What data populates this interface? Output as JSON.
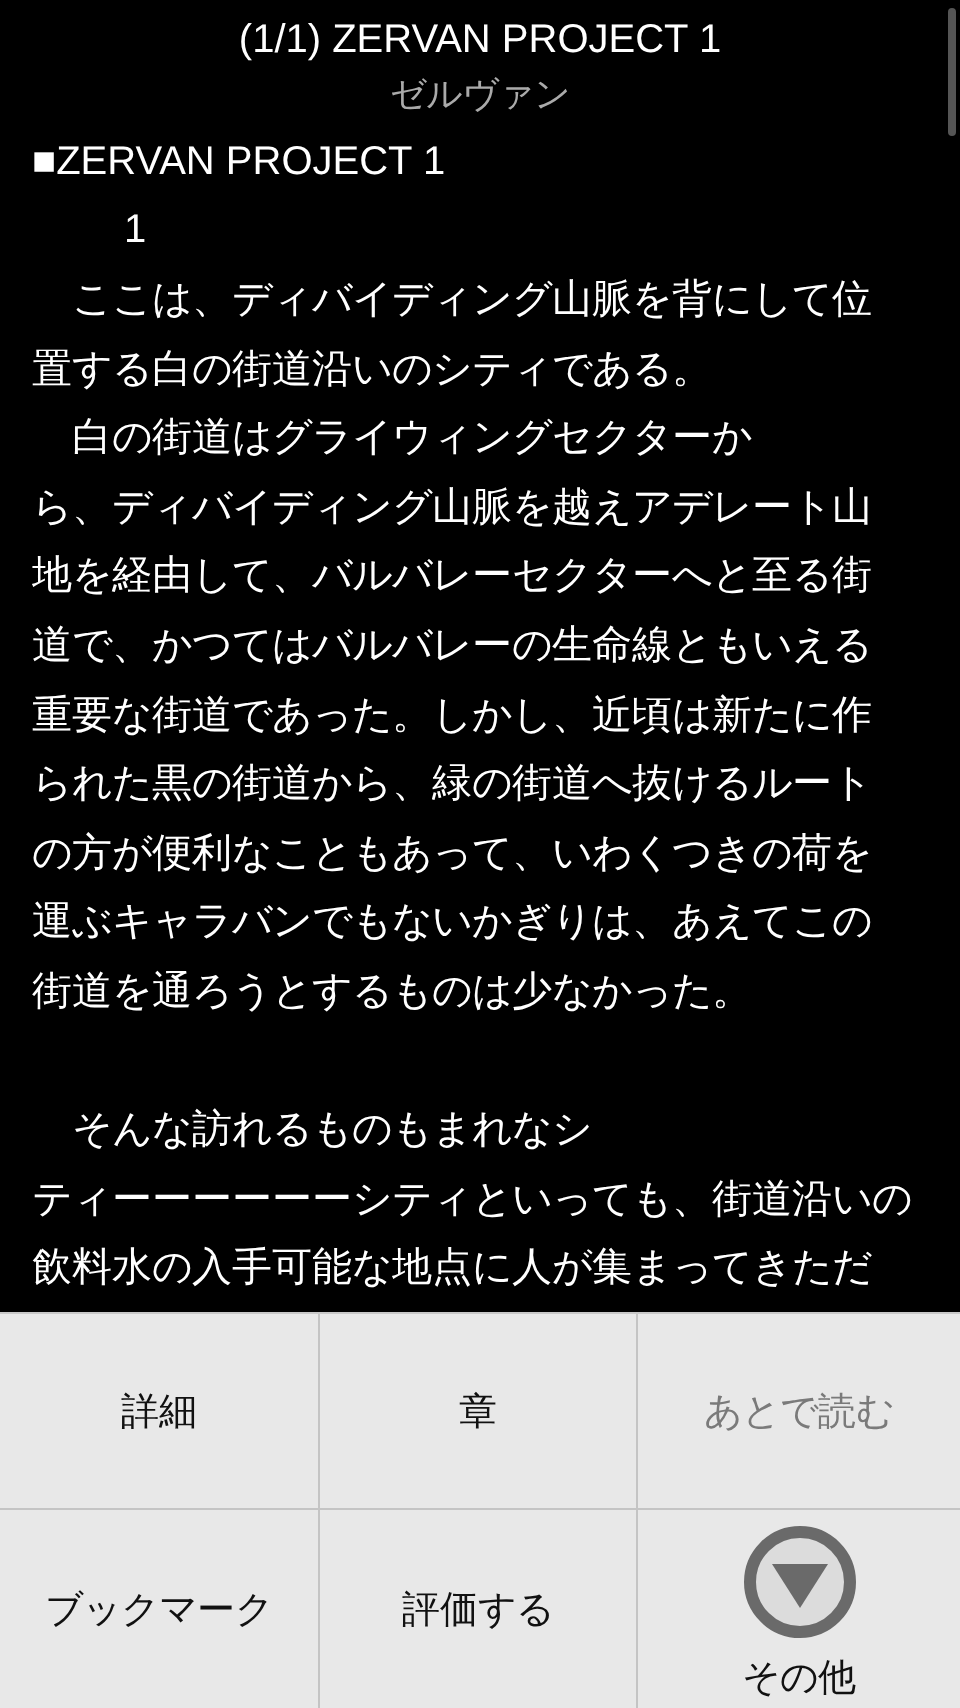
{
  "header": {
    "title": "(1/1) ZERVAN PROJECT 1",
    "subtitle": "ゼルヴァン"
  },
  "body": {
    "heading": "■ZERVAN PROJECT 1",
    "chapter_number": "1",
    "paragraphs": [
      {
        "lines": [
          "　ここは、ディバイディング山脈を背にして位",
          "置する白の街道沿いのシティである。"
        ]
      },
      {
        "lines": [
          "　白の街道はグライウィングセクターか",
          "ら、ディバイディング山脈を越えアデレート山",
          "地を経由して、バルバレーセクターへと至る街",
          "道で、かつてはバルバレーの生命線ともいえる",
          "重要な街道であった。しかし、近頃は新たに作",
          "られた黒の街道から、緑の街道へ抜けるルート",
          "の方が便利なこともあって、いわくつきの荷を",
          "運ぶキャラバンでもないかぎりは、あえてこの",
          "街道を通ろうとするものは少なかった。"
        ]
      },
      {
        "lines": [
          "　そんな訪れるものもまれなシ",
          "ティーーーーーーシティといっても、街道沿いの",
          "飲料水の入手可能な地点に人が集まってきただ"
        ]
      }
    ]
  },
  "menu": [
    {
      "label": "詳細",
      "kind": "text",
      "disabled": false
    },
    {
      "label": "章",
      "kind": "text",
      "disabled": false
    },
    {
      "label": "あとで読む",
      "kind": "text",
      "disabled": true
    },
    {
      "label": "ブックマーク",
      "kind": "text",
      "disabled": false
    },
    {
      "label": "評価する",
      "kind": "text",
      "disabled": false
    },
    {
      "label": "その他",
      "kind": "more",
      "disabled": false
    }
  ]
}
